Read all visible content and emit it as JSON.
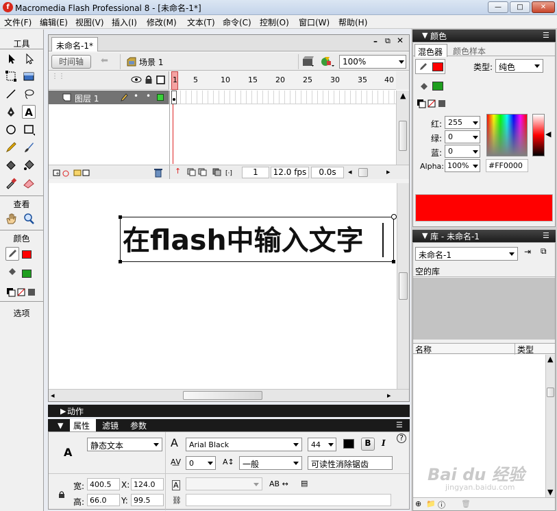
{
  "window": {
    "title": "Macromedia Flash Professional 8 - [未命名-1*]",
    "logo_letter": "f",
    "buttons": {
      "minimize": "—",
      "maximize": "□",
      "close": "✕"
    }
  },
  "menu": [
    "文件(F)",
    "编辑(E)",
    "视图(V)",
    "插入(I)",
    "修改(M)",
    "文本(T)",
    "命令(C)",
    "控制(O)",
    "窗口(W)",
    "帮助(H)"
  ],
  "tools": {
    "title": "工具",
    "view_title": "查看",
    "color_title": "颜色",
    "options_title": "选项",
    "items": {
      "arrow": "arrow-icon",
      "subselect": "subselect-icon",
      "free_transform": "free-transform-icon",
      "gradient_transform": "gradient-transform-icon",
      "line": "line-icon",
      "lasso": "lasso-icon",
      "pen": "pen-icon",
      "text": "A",
      "oval": "oval-icon",
      "rectangle": "rectangle-icon",
      "pencil": "pencil-icon",
      "brush": "brush-icon",
      "ink_bottle": "ink-bottle-icon",
      "paint_bucket": "paint-bucket-icon",
      "eyedropper": "eyedropper-icon",
      "eraser": "eraser-icon",
      "hand": "hand-icon",
      "zoom": "zoom-icon"
    }
  },
  "colors": {
    "stroke": "#ff0000",
    "fill": "#1e9e1e",
    "stage_text": "#111111",
    "panel_header": "#222222"
  },
  "document": {
    "tab_title": "未命名-1*",
    "timeline_button": "时间轴",
    "scene_label": "场景 1",
    "zoom": "100%",
    "ruler_numbers": [
      "1",
      "5",
      "10",
      "15",
      "20",
      "25",
      "30",
      "35",
      "40"
    ],
    "layer_name": "图层 1",
    "frame_number": "1",
    "fps": "12.0 fps",
    "time": "0.0s",
    "stage_text_prefix": "在",
    "stage_text_latin": "flash",
    "stage_text_suffix": "中输入文字"
  },
  "actions_panel": {
    "title": "动作"
  },
  "properties": {
    "tabs": [
      "属性",
      "滤镜",
      "参数"
    ],
    "text_type": "静态文本",
    "font": "Arial Black",
    "size": "44",
    "bold": "B",
    "italic": "I",
    "letter_spacing": "0",
    "baseline": "一般",
    "aliasing": "可读性消除锯齿",
    "labels": {
      "w": "宽:",
      "h": "高:",
      "x": "X:",
      "y": "Y:"
    },
    "w": "400.5",
    "h": "66.0",
    "x": "124.0",
    "y": "99.5"
  },
  "color_panel": {
    "title": "颜色",
    "tabs": [
      "混色器",
      "颜色样本"
    ],
    "type_label": "类型:",
    "type_value": "纯色",
    "labels": {
      "r": "红:",
      "g": "绿:",
      "b": "蓝:",
      "alpha": "Alpha:"
    },
    "r": "255",
    "g": "0",
    "b": "0",
    "alpha": "100%",
    "hex": "#FF0000",
    "preview_color": "#ff0000"
  },
  "library_panel": {
    "title": "库 - 未命名-1",
    "doc": "未命名-1",
    "empty": "空的库",
    "columns": [
      "名称",
      "类型"
    ]
  },
  "watermark": {
    "brand": "Bai du 经验",
    "url": "jingyan.baidu.com"
  }
}
